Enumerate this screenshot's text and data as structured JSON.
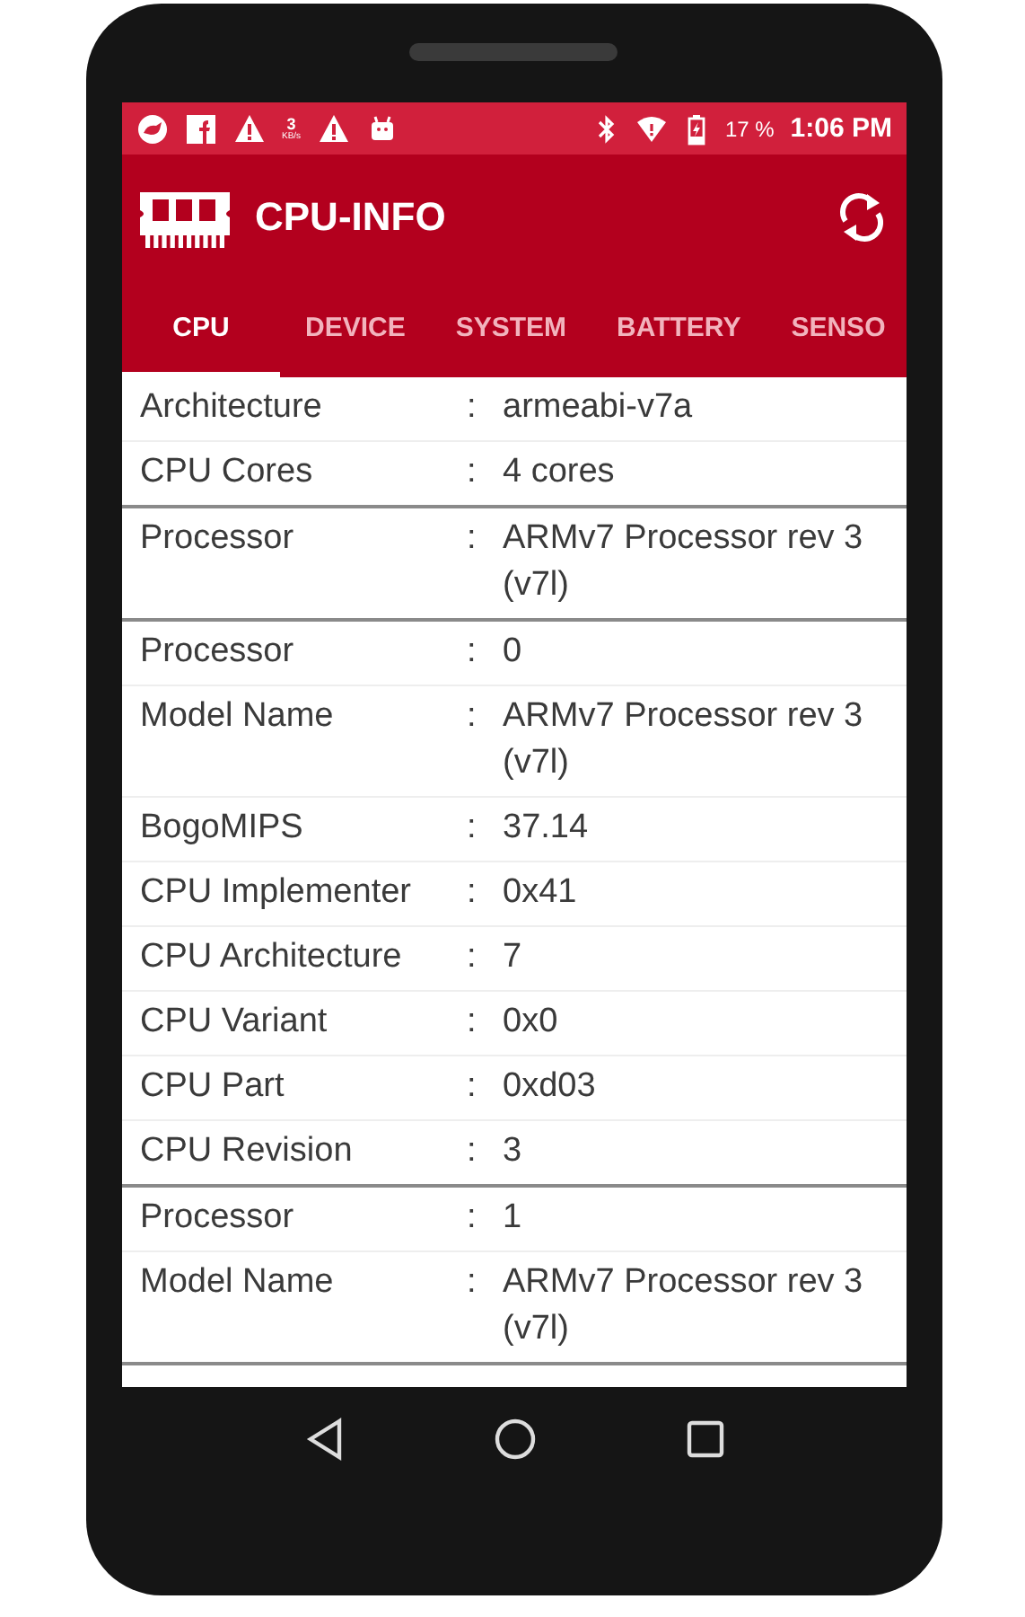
{
  "status_bar": {
    "speed_value": "3",
    "speed_unit": "KB/s",
    "battery": "17 %",
    "time": "1:06 PM"
  },
  "app_bar": {
    "title": "CPU-INFO"
  },
  "tabs": [
    {
      "label": "CPU",
      "selected": true
    },
    {
      "label": "DEVICE",
      "selected": false
    },
    {
      "label": "SYSTEM",
      "selected": false
    },
    {
      "label": "BATTERY",
      "selected": false
    },
    {
      "label": "SENSO",
      "selected": false
    }
  ],
  "sections": [
    {
      "rows": [
        {
          "label": "Architecture",
          "value": "armeabi-v7a"
        },
        {
          "label": "CPU Cores",
          "value": "4 cores"
        }
      ]
    },
    {
      "rows": [
        {
          "label": "Processor",
          "value": "ARMv7 Processor rev 3 (v7l)"
        }
      ]
    },
    {
      "rows": [
        {
          "label": "Processor",
          "value": "0"
        },
        {
          "label": "Model Name",
          "value": "ARMv7 Processor rev 3 (v7l)"
        },
        {
          "label": "BogoMIPS",
          "value": "37.14"
        },
        {
          "label": "CPU Implementer",
          "value": "0x41"
        },
        {
          "label": "CPU Architecture",
          "value": "7"
        },
        {
          "label": "CPU Variant",
          "value": "0x0"
        },
        {
          "label": "CPU Part",
          "value": "0xd03"
        },
        {
          "label": "CPU Revision",
          "value": "3"
        }
      ]
    },
    {
      "rows": [
        {
          "label": "Processor",
          "value": "1"
        },
        {
          "label": "Model Name",
          "value": "ARMv7 Processor rev 3 (v7l)"
        }
      ]
    }
  ],
  "separator": ":"
}
